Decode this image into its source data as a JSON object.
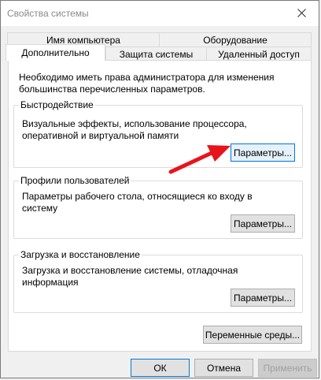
{
  "window": {
    "title": "Свойства системы"
  },
  "tabs": {
    "row1": [
      "Имя компьютера",
      "Оборудование"
    ],
    "row2": [
      "Дополнительно",
      "Защита системы",
      "Удаленный доступ"
    ]
  },
  "admin_note": "Необходимо иметь права администратора для изменения большинства перечисленных параметров.",
  "performance": {
    "title": "Быстродействие",
    "text": "Визуальные эффекты, использование процессора, оперативной и виртуальной памяти",
    "button": "Параметры..."
  },
  "profiles": {
    "title": "Профили пользователей",
    "text": "Параметры рабочего стола, относящиеся ко входу в систему",
    "button": "Параметры..."
  },
  "startup": {
    "title": "Загрузка и восстановление",
    "text": "Загрузка и восстановление системы, отладочная информация",
    "button": "Параметры..."
  },
  "env_button": "Переменные среды...",
  "footer": {
    "ok": "ОК",
    "cancel": "Отмена",
    "apply": "Применить"
  },
  "colors": {
    "accent": "#0078d7",
    "arrow": "#e8141b"
  }
}
